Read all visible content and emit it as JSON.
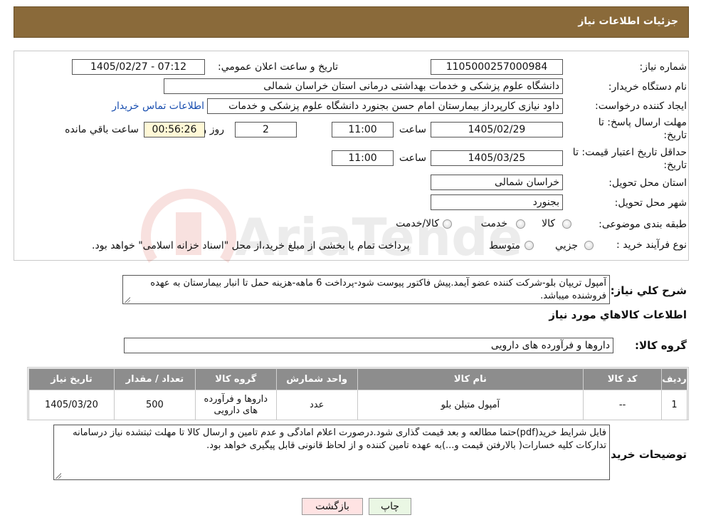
{
  "header": {
    "title": "جزئیات اطلاعات نیاز"
  },
  "watermark": {
    "text": "AriaTender.neT"
  },
  "fields": {
    "need_number_label": "شماره نیاز:",
    "need_number": "1105000257000984",
    "announce_label": "تاریخ و ساعت اعلان عمومي:",
    "announce_value": "1405/02/27 - 07:12",
    "buyer_org_label": "نام دستگاه خریدار:",
    "buyer_org": "دانشگاه علوم پزشکی و خدمات بهداشتی درمانی استان خراسان شمالی",
    "creator_label": "ایجاد کننده درخواست:",
    "creator": "داود نیازی کارپرداز بیمارستان امام حسن بجنورد دانشگاه علوم پزشکی و خدمات",
    "contact_link": "اطلاعات تماس خریدار",
    "reply_deadline_label_1": "مهلت ارسال پاسخ: تا",
    "reply_deadline_label_2": "تاریخ:",
    "reply_date": "1405/02/29",
    "time_label": "ساعت",
    "reply_time": "11:00",
    "days_value": "2",
    "days_label": "روز و",
    "remaining_time": "00:56:26",
    "remaining_label": "ساعت باقي مانده",
    "validity_label_1": "حداقل تاریخ اعتبار قیمت: تا",
    "validity_label_2": "تاریخ:",
    "validity_date": "1405/03/25",
    "validity_time": "11:00",
    "province_label": "استان محل تحویل:",
    "province": "خراسان شمالی",
    "city_label": "شهر محل تحویل:",
    "city": "بجنورد",
    "category_label": "طبقه بندی موضوعی:",
    "category_options": [
      "کالا",
      "خدمت",
      "کالا/خدمت"
    ],
    "process_label": "نوع فرآیند خرید :",
    "process_options": [
      "جزيي",
      "متوسط"
    ],
    "process_note": "پرداخت تمام یا بخشی از مبلغ خرید،از محل \"اسناد خزانه اسلامی\" خواهد بود."
  },
  "description": {
    "label": "شرح کلي نياز:",
    "text": "آمپول تریپان بلو-شرکت کننده عضو آیمد.پیش فاکتور پیوست  شود-پرداخت 6 ماهه-هزینه حمل تا انبار بیمارستان به عهده فروشنده میباشد."
  },
  "goods_section": {
    "title": "اطلاعات کالاهاي مورد نياز",
    "group_label": "گروه کالا:",
    "group_value": "داروها و فرآورده های دارویی"
  },
  "table": {
    "headers": [
      "رديف",
      "کد کالا",
      "نام کالا",
      "واحد شمارش",
      "گروه کالا",
      "تعداد / مقدار",
      "تاریخ نیاز"
    ],
    "rows": [
      {
        "row": "1",
        "code": "--",
        "name": "آمپول متیلن بلو",
        "unit": "عدد",
        "group": "داروها و فرآورده های دارویی",
        "qty": "500",
        "date": "1405/03/20"
      }
    ]
  },
  "buyer_notes": {
    "label": "توضیحات خریدار:",
    "text": "فایل شرایط خرید(pdf)حتما مطالعه و بعد قیمت گذاری شود.درصورت اعلام امادگی و عدم تامین و ارسال کالا تا مهلت ثبتشده نیاز درسامانه تدارکات کلیه خسارات( بالارفتن قیمت و...)به عهده تامین کننده و از لحاظ قانونی قابل پیگیری خواهد بود."
  },
  "buttons": {
    "print": "چاپ",
    "back": "بازگشت"
  },
  "colors": {
    "header_bg": "#8a6a3a",
    "table_header_bg": "#8d8d8d",
    "remaining_bg": "#fff8d6",
    "back_bg": "#ffe3e3",
    "print_bg": "#eaf7e4",
    "link": "#1a4fb0"
  }
}
